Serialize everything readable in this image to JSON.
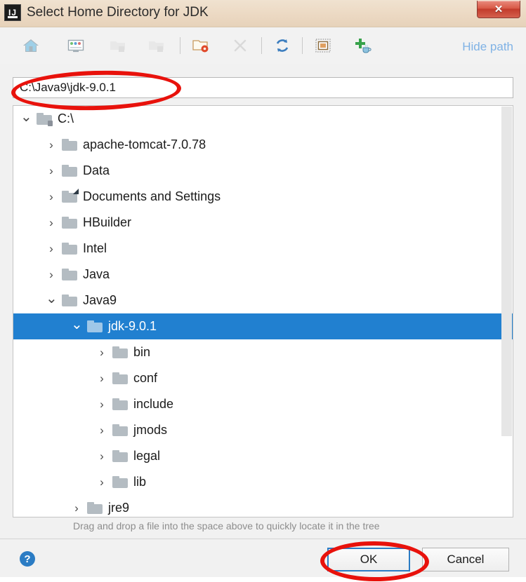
{
  "window": {
    "title": "Select Home Directory for JDK",
    "app_icon": "intellij-idea-icon",
    "close_label": "✕"
  },
  "toolbar": {
    "buttons": [
      {
        "name": "home-icon",
        "label": "Home",
        "enabled": true
      },
      {
        "name": "desktop-icon",
        "label": "Desktop",
        "enabled": true
      },
      {
        "name": "folder-up-icon",
        "label": "Up",
        "enabled": false
      },
      {
        "name": "folder-prev-icon",
        "label": "Previous Folder",
        "enabled": false
      },
      {
        "name": "new-folder-icon",
        "label": "New Folder",
        "enabled": true
      },
      {
        "name": "delete-icon",
        "label": "Delete",
        "enabled": false
      },
      {
        "name": "refresh-icon",
        "label": "Refresh",
        "enabled": true
      },
      {
        "name": "show-hidden-icon",
        "label": "Show Hidden Files",
        "enabled": true
      },
      {
        "name": "add-jdk-icon",
        "label": "Add JDK",
        "enabled": true
      }
    ],
    "hide_path_label": "Hide path"
  },
  "path_field": {
    "value": "C:\\Java9\\jdk-9.0.1",
    "placeholder": ""
  },
  "tree": {
    "rows": [
      {
        "label": "C:\\",
        "depth": 0,
        "state": "expanded",
        "badge": "lock",
        "selected": false
      },
      {
        "label": "apache-tomcat-7.0.78",
        "depth": 1,
        "state": "collapsed",
        "badge": "none",
        "selected": false
      },
      {
        "label": "Data",
        "depth": 1,
        "state": "collapsed",
        "badge": "none",
        "selected": false
      },
      {
        "label": "Documents and Settings",
        "depth": 1,
        "state": "collapsed",
        "badge": "shortcut",
        "selected": false
      },
      {
        "label": "HBuilder",
        "depth": 1,
        "state": "collapsed",
        "badge": "none",
        "selected": false
      },
      {
        "label": "Intel",
        "depth": 1,
        "state": "collapsed",
        "badge": "none",
        "selected": false
      },
      {
        "label": "Java",
        "depth": 1,
        "state": "collapsed",
        "badge": "none",
        "selected": false
      },
      {
        "label": "Java9",
        "depth": 1,
        "state": "expanded",
        "badge": "none",
        "selected": false
      },
      {
        "label": "jdk-9.0.1",
        "depth": 2,
        "state": "expanded",
        "badge": "none",
        "selected": true
      },
      {
        "label": "bin",
        "depth": 3,
        "state": "collapsed",
        "badge": "none",
        "selected": false
      },
      {
        "label": "conf",
        "depth": 3,
        "state": "collapsed",
        "badge": "none",
        "selected": false
      },
      {
        "label": "include",
        "depth": 3,
        "state": "collapsed",
        "badge": "none",
        "selected": false
      },
      {
        "label": "jmods",
        "depth": 3,
        "state": "collapsed",
        "badge": "none",
        "selected": false
      },
      {
        "label": "legal",
        "depth": 3,
        "state": "collapsed",
        "badge": "none",
        "selected": false
      },
      {
        "label": "lib",
        "depth": 3,
        "state": "collapsed",
        "badge": "none",
        "selected": false
      },
      {
        "label": "jre9",
        "depth": 2,
        "state": "collapsed",
        "badge": "none",
        "selected": false
      }
    ],
    "chevron_expanded": "⌄",
    "chevron_collapsed": "›"
  },
  "hint": {
    "text": "Drag and drop a file into the space above to quickly locate it in the tree"
  },
  "footer": {
    "help_label": "?",
    "ok_label": "OK",
    "cancel_label": "Cancel"
  },
  "annotations": [
    {
      "name": "annotation-ellipse-path",
      "shape": "ellipse",
      "color": "#e8120c",
      "target": "path-field"
    },
    {
      "name": "annotation-ellipse-ok",
      "shape": "ellipse",
      "color": "#e8120c",
      "target": "ok-button"
    }
  ],
  "colors": {
    "titlebar": "#ecd9c3",
    "selection": "#2180d0",
    "link": "#7fb2e5",
    "annotation": "#e8120c",
    "folder": "#b4bcc2"
  }
}
